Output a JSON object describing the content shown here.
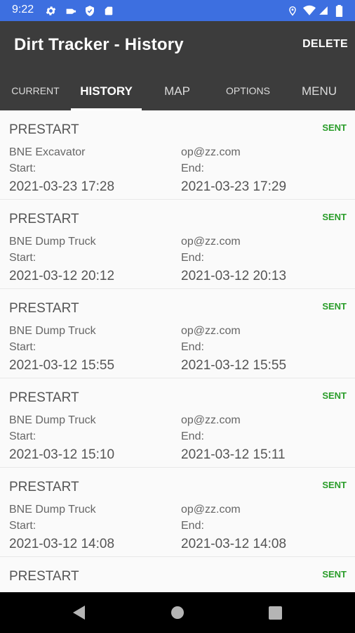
{
  "status_bar": {
    "time": "9:22",
    "left_icons": [
      "gear-icon",
      "key-icon",
      "shield-icon",
      "sd-card-icon"
    ],
    "right_icons": [
      "location-pin-icon",
      "wifi-icon",
      "signal-icon",
      "battery-icon"
    ]
  },
  "app_bar": {
    "title": "Dirt Tracker - History",
    "delete_label": "DELETE"
  },
  "tabs": [
    {
      "label": "CURRENT",
      "active": false
    },
    {
      "label": "HISTORY",
      "active": true
    },
    {
      "label": "MAP",
      "active": false
    },
    {
      "label": "OPTIONS",
      "active": false
    },
    {
      "label": "MENU",
      "active": false
    }
  ],
  "history": [
    {
      "type": "PRESTART",
      "status": "SENT",
      "machine": "BNE Excavator",
      "user": "op@zz.com",
      "start_label": "Start:",
      "end_label": "End:",
      "start": "2021-03-23 17:28",
      "end": "2021-03-23 17:29"
    },
    {
      "type": "PRESTART",
      "status": "SENT",
      "machine": "BNE Dump Truck",
      "user": "op@zz.com",
      "start_label": "Start:",
      "end_label": "End:",
      "start": "2021-03-12 20:12",
      "end": "2021-03-12 20:13"
    },
    {
      "type": "PRESTART",
      "status": "SENT",
      "machine": "BNE Dump Truck",
      "user": "op@zz.com",
      "start_label": "Start:",
      "end_label": "End:",
      "start": "2021-03-12 15:55",
      "end": "2021-03-12 15:55"
    },
    {
      "type": "PRESTART",
      "status": "SENT",
      "machine": "BNE Dump Truck",
      "user": "op@zz.com",
      "start_label": "Start:",
      "end_label": "End:",
      "start": "2021-03-12 15:10",
      "end": "2021-03-12 15:11"
    },
    {
      "type": "PRESTART",
      "status": "SENT",
      "machine": "BNE Dump Truck",
      "user": "op@zz.com",
      "start_label": "Start:",
      "end_label": "End:",
      "start": "2021-03-12 14:08",
      "end": "2021-03-12 14:08"
    },
    {
      "type": "PRESTART",
      "status": "SENT"
    }
  ],
  "nav_bar": {
    "buttons": [
      "back-icon",
      "home-icon",
      "recents-icon"
    ]
  },
  "colors": {
    "status_bar": "#3d6fe0",
    "app_bar": "#3c3c3c",
    "sent_green": "#2a9d2a",
    "list_background": "#fafafa"
  }
}
